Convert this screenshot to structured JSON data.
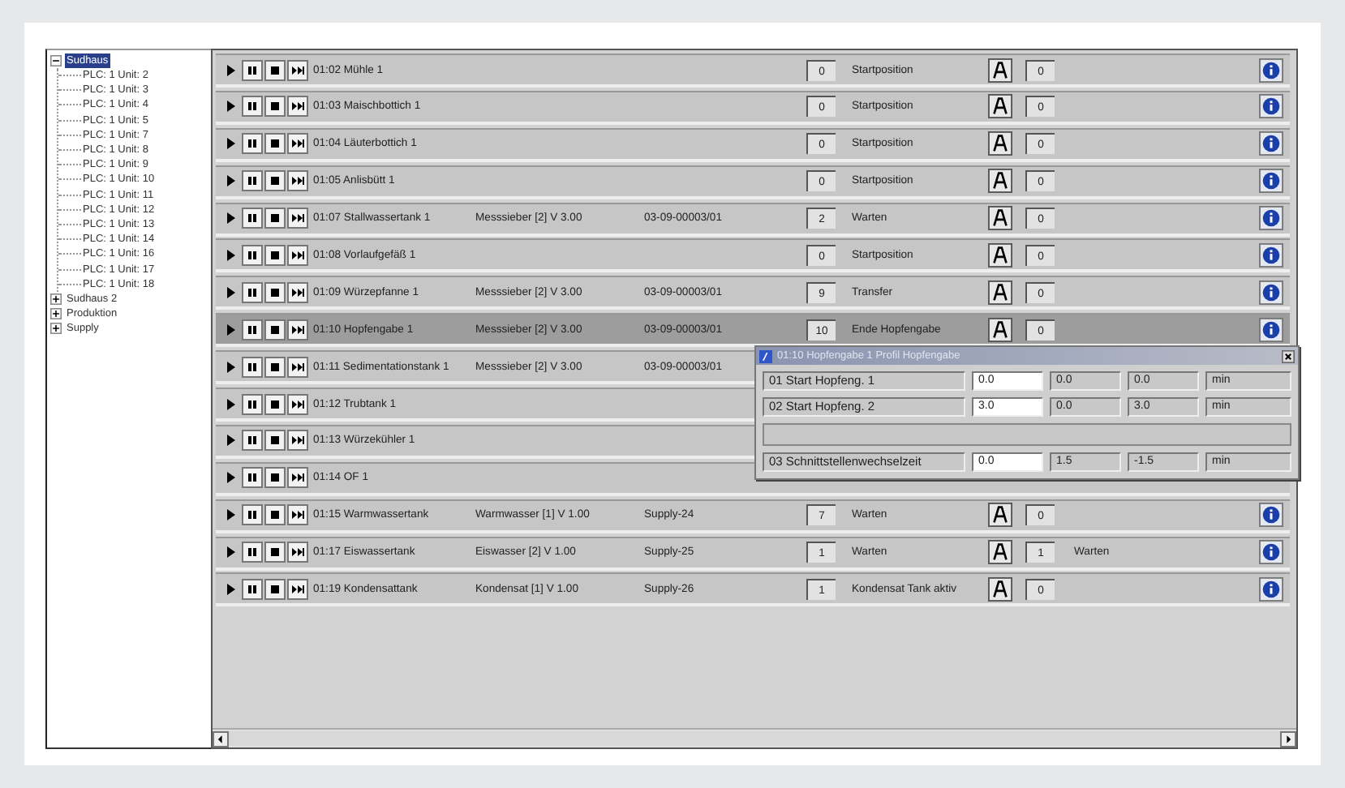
{
  "tree": [
    {
      "label": "Sudhaus",
      "expanded": true,
      "selected": true,
      "children": [
        {
          "label": "PLC: 1 Unit: 2"
        },
        {
          "label": "PLC: 1 Unit: 3"
        },
        {
          "label": "PLC: 1 Unit: 4"
        },
        {
          "label": "PLC: 1 Unit: 5"
        },
        {
          "label": "PLC: 1 Unit: 7"
        },
        {
          "label": "PLC: 1 Unit: 8"
        },
        {
          "label": "PLC: 1 Unit: 9"
        },
        {
          "label": "PLC: 1 Unit: 10"
        },
        {
          "label": "PLC: 1 Unit: 11"
        },
        {
          "label": "PLC: 1 Unit: 12"
        },
        {
          "label": "PLC: 1 Unit: 13"
        },
        {
          "label": "PLC: 1 Unit: 14"
        },
        {
          "label": "PLC: 1 Unit: 16"
        },
        {
          "label": "PLC: 1 Unit: 17"
        },
        {
          "label": "PLC: 1 Unit: 18"
        }
      ]
    },
    {
      "label": "Sudhaus 2",
      "expanded": false,
      "selected": false
    },
    {
      "label": "Produktion",
      "expanded": false,
      "selected": false
    },
    {
      "label": "Supply",
      "expanded": false,
      "selected": false
    }
  ],
  "units": [
    {
      "name": "01:02 Mühle 1",
      "selected": false,
      "count": "0",
      "status": "Startposition",
      "print": true,
      "value": "0",
      "info": true
    },
    {
      "name": "01:03 Maischbottich 1",
      "selected": false,
      "count": "0",
      "status": "Startposition",
      "print": true,
      "value": "0",
      "info": true
    },
    {
      "name": "01:04 Läuterbottich 1",
      "selected": false,
      "count": "0",
      "status": "Startposition",
      "print": true,
      "value": "0",
      "info": true
    },
    {
      "name": "01:05 Anlisbütt 1",
      "selected": false,
      "count": "0",
      "status": "Startposition",
      "print": true,
      "value": "0",
      "info": true
    },
    {
      "name": "01:07 Stallwassertank 1",
      "device": "Messsieber [2] V 3.00",
      "serial": "03-09-00003/01",
      "selected": false,
      "count": "2",
      "status": "Warten",
      "print": true,
      "value": "0",
      "info": true
    },
    {
      "name": "01:08 Vorlaufgefäß 1",
      "selected": false,
      "count": "0",
      "status": "Startposition",
      "print": true,
      "value": "0",
      "info": true
    },
    {
      "name": "01:09 Würzepfanne 1",
      "device": "Messsieber [2] V 3.00",
      "serial": "03-09-00003/01",
      "selected": false,
      "count": "9",
      "status": "Transfer",
      "print": true,
      "value": "0",
      "info": true
    },
    {
      "name": "01:10 Hopfengabe 1",
      "device": "Messsieber [2] V 3.00",
      "serial": "03-09-00003/01",
      "selected": true,
      "count": "10",
      "status": "Ende Hopfengabe",
      "print": true,
      "value": "0",
      "info": true
    },
    {
      "name": "01:11 Sedimentationstank 1",
      "device": "Messsieber [2] V 3.00",
      "serial": "03-09-00003/01",
      "selected": false,
      "print": false,
      "info": false
    },
    {
      "name": "01:12 Trubtank 1",
      "selected": false,
      "print": false,
      "info": false
    },
    {
      "name": "01:13 Würzekühler 1",
      "selected": false,
      "print": false,
      "info": false
    },
    {
      "name": "01:14 OF 1",
      "selected": false,
      "print": false,
      "info": false
    },
    {
      "name": "01:15 Warmwassertank",
      "device": "Warmwasser [1] V 1.00",
      "serial": "Supply-24",
      "selected": false,
      "count": "7",
      "status": "Warten",
      "print": true,
      "value": "0",
      "info": true
    },
    {
      "name": "01:17 Eiswassertank",
      "device": "Eiswasser [2] V 1.00",
      "serial": "Supply-25",
      "selected": false,
      "count": "1",
      "status": "Warten",
      "print": true,
      "value": "1",
      "extra": "Warten",
      "info": true
    },
    {
      "name": "01:19 Kondensattank",
      "device": "Kondensat [1] V 1.00",
      "serial": "Supply-26",
      "selected": false,
      "count": "1",
      "status": "Kondensat Tank aktiv",
      "print": true,
      "value": "0",
      "info": true
    }
  ],
  "popup": {
    "title": "01:10 Hopfengabe 1 Profil Hopfengabe",
    "rows": [
      {
        "kind": "param",
        "label": "01 Start Hopfeng. 1",
        "value": "0.0",
        "col_3": "0.0",
        "col_4": "0.0",
        "unit": "min"
      },
      {
        "kind": "param",
        "label": "02 Start Hopfeng. 2",
        "value": "3.0",
        "col_3": "0.0",
        "col_4": "3.0",
        "unit": "min"
      },
      {
        "kind": "blank"
      },
      {
        "kind": "param",
        "label": "03 Schnittstellenwechselzeit",
        "value": "0.0",
        "col_3": "1.5",
        "col_4": "-1.5",
        "unit": "min"
      }
    ]
  }
}
